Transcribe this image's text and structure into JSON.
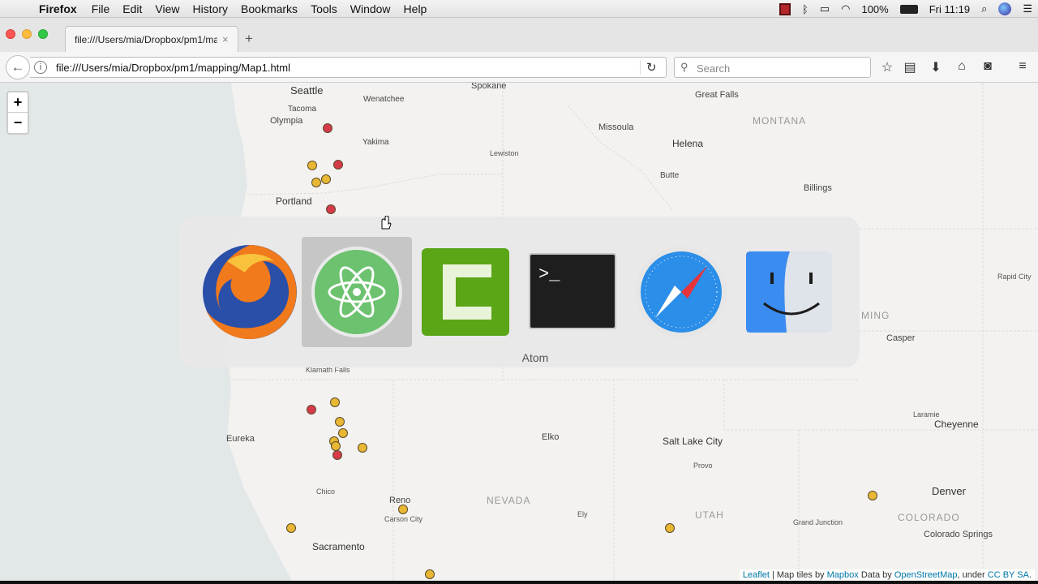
{
  "menubar": {
    "app_name": "Firefox",
    "items": [
      "File",
      "Edit",
      "View",
      "History",
      "Bookmarks",
      "Tools",
      "Window",
      "Help"
    ],
    "battery": "100%",
    "clock": "Fri 11:19"
  },
  "tab": {
    "title": "file:///Users/mia/Dropbox/pm1/ma",
    "close": "×"
  },
  "newtab": "+",
  "urlbar": {
    "url": "file:///Users/mia/Dropbox/pm1/mapping/Map1.html"
  },
  "search": {
    "placeholder": "Search"
  },
  "zoom": {
    "in": "+",
    "out": "−"
  },
  "map": {
    "cities": [
      "Seattle",
      "Tacoma",
      "Olympia",
      "Wenatchee",
      "Spokane",
      "Yakima",
      "Lewiston",
      "Missoula",
      "Great Falls",
      "Helena",
      "Butte",
      "MONTANA",
      "Billings",
      "Portland",
      "Rapid City",
      "MING",
      "Casper",
      "Klamath Falls",
      "Eureka",
      "Elko",
      "Salt Lake City",
      "Provo",
      "Laramie",
      "Cheyenne",
      "Chico",
      "Reno",
      "Carson City",
      "NEVADA",
      "Ely",
      "UTAH",
      "Grand Junction",
      "Denver",
      "COLORADO",
      "Colorado Springs",
      "Sacramento"
    ],
    "marker_colors": {
      "yellow": "#e8b733",
      "red": "#d63a4a"
    }
  },
  "attribution": {
    "leaflet": "Leaflet",
    "tiles_prefix": "| Map tiles by",
    "mapbox": "Mapbox",
    "data_prefix": "Data by",
    "osm": "OpenStreetMap",
    "under": ", under",
    "license": "CC BY SA",
    "end": "."
  },
  "switcher": {
    "apps": [
      "Firefox",
      "Atom",
      "Camtasia",
      "Terminal",
      "Safari",
      "Finder"
    ],
    "selected_label": "Atom"
  }
}
